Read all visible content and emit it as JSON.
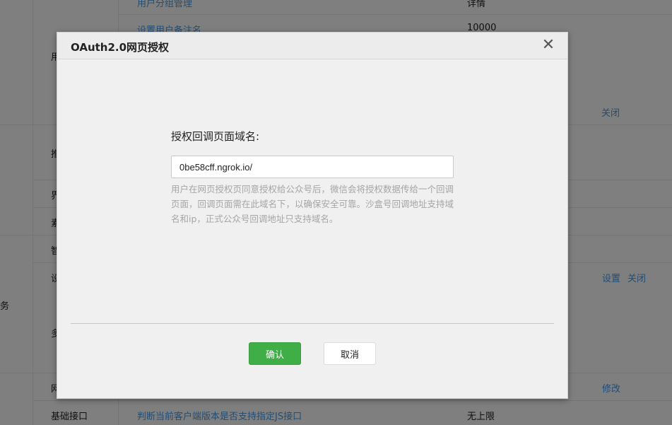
{
  "background": {
    "rows": [
      {
        "col1": "",
        "col2": "用户分组管理",
        "col3": "详情"
      },
      {
        "col1": "",
        "col2": "设置用户备注名",
        "col3": "10000"
      },
      {
        "col1": "用",
        "col2": "",
        "col3": ""
      },
      {
        "col1": "",
        "col2": "",
        "col3": "",
        "action": "关闭"
      },
      {
        "col1": "推",
        "col2": "",
        "col3": ""
      },
      {
        "col1": "界",
        "col2": "",
        "col3": ""
      },
      {
        "col1": "素",
        "col2": "",
        "col3": ""
      },
      {
        "col1": "智",
        "col2": "",
        "col3": ""
      },
      {
        "col1": "设",
        "col2": "",
        "col3": "",
        "action": "设置",
        "action2": "关闭"
      },
      {
        "col1": "多",
        "col2": "",
        "col3": ""
      },
      {
        "col1": "网",
        "col2": "",
        "col3": "",
        "action": "修改"
      },
      {
        "col1": "基础接口",
        "col2": "判断当前客户端版本是否支持指定JS接口",
        "col3": "无上限"
      }
    ],
    "side_label": "务"
  },
  "dialog": {
    "title": "OAuth2.0网页授权",
    "close_symbol": "✕",
    "field_label": "授权回调页面域名:",
    "domain_value": "0be58cff.ngrok.io/",
    "help_text": "用户在网页授权页同意授权给公众号后，微信会将授权数据传给一个回调页面，回调页面需在此域名下，以确保安全可靠。沙盒号回调地址支持域名和ip，正式公众号回调地址只支持域名。",
    "confirm_label": "确认",
    "cancel_label": "取消"
  },
  "colors": {
    "confirm": "#3fae46",
    "link": "#459ae9",
    "overlay": "rgba(0,0,0,0.5)"
  }
}
